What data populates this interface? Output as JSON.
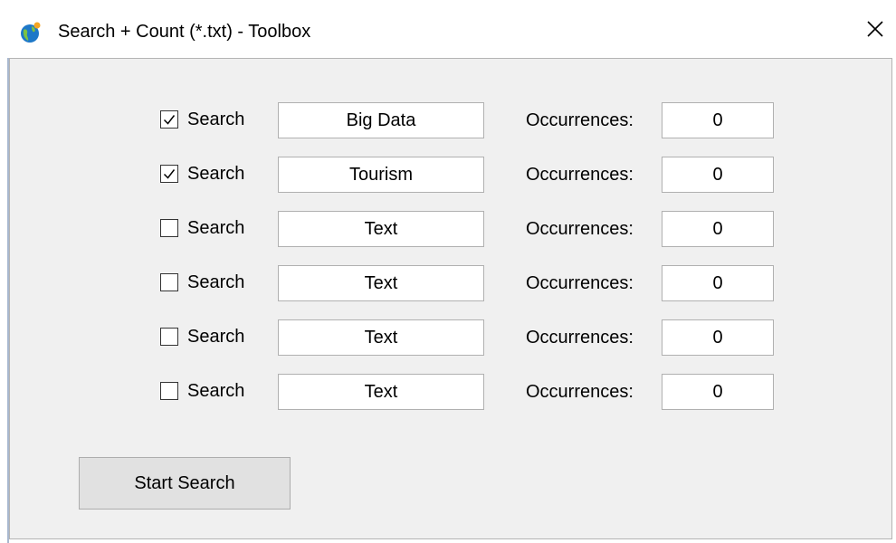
{
  "window": {
    "title": "Search + Count (*.txt) - Toolbox",
    "app_icon": "globe-icon",
    "close_icon": "close-icon"
  },
  "rows": [
    {
      "checked": true,
      "label": "Search",
      "term": "Big Data",
      "occ_label": "Occurrences:",
      "count": "0"
    },
    {
      "checked": true,
      "label": "Search",
      "term": "Tourism",
      "occ_label": "Occurrences:",
      "count": "0"
    },
    {
      "checked": false,
      "label": "Search",
      "term": "Text",
      "occ_label": "Occurrences:",
      "count": "0"
    },
    {
      "checked": false,
      "label": "Search",
      "term": "Text",
      "occ_label": "Occurrences:",
      "count": "0"
    },
    {
      "checked": false,
      "label": "Search",
      "term": "Text",
      "occ_label": "Occurrences:",
      "count": "0"
    },
    {
      "checked": false,
      "label": "Search",
      "term": "Text",
      "occ_label": "Occurrences:",
      "count": "0"
    }
  ],
  "start_button": {
    "label": "Start Search"
  },
  "colors": {
    "client_background": "#f0f0f0",
    "button_background": "#e1e1e1",
    "icon_blue": "#1e78c8",
    "icon_orange": "#f5a623"
  }
}
